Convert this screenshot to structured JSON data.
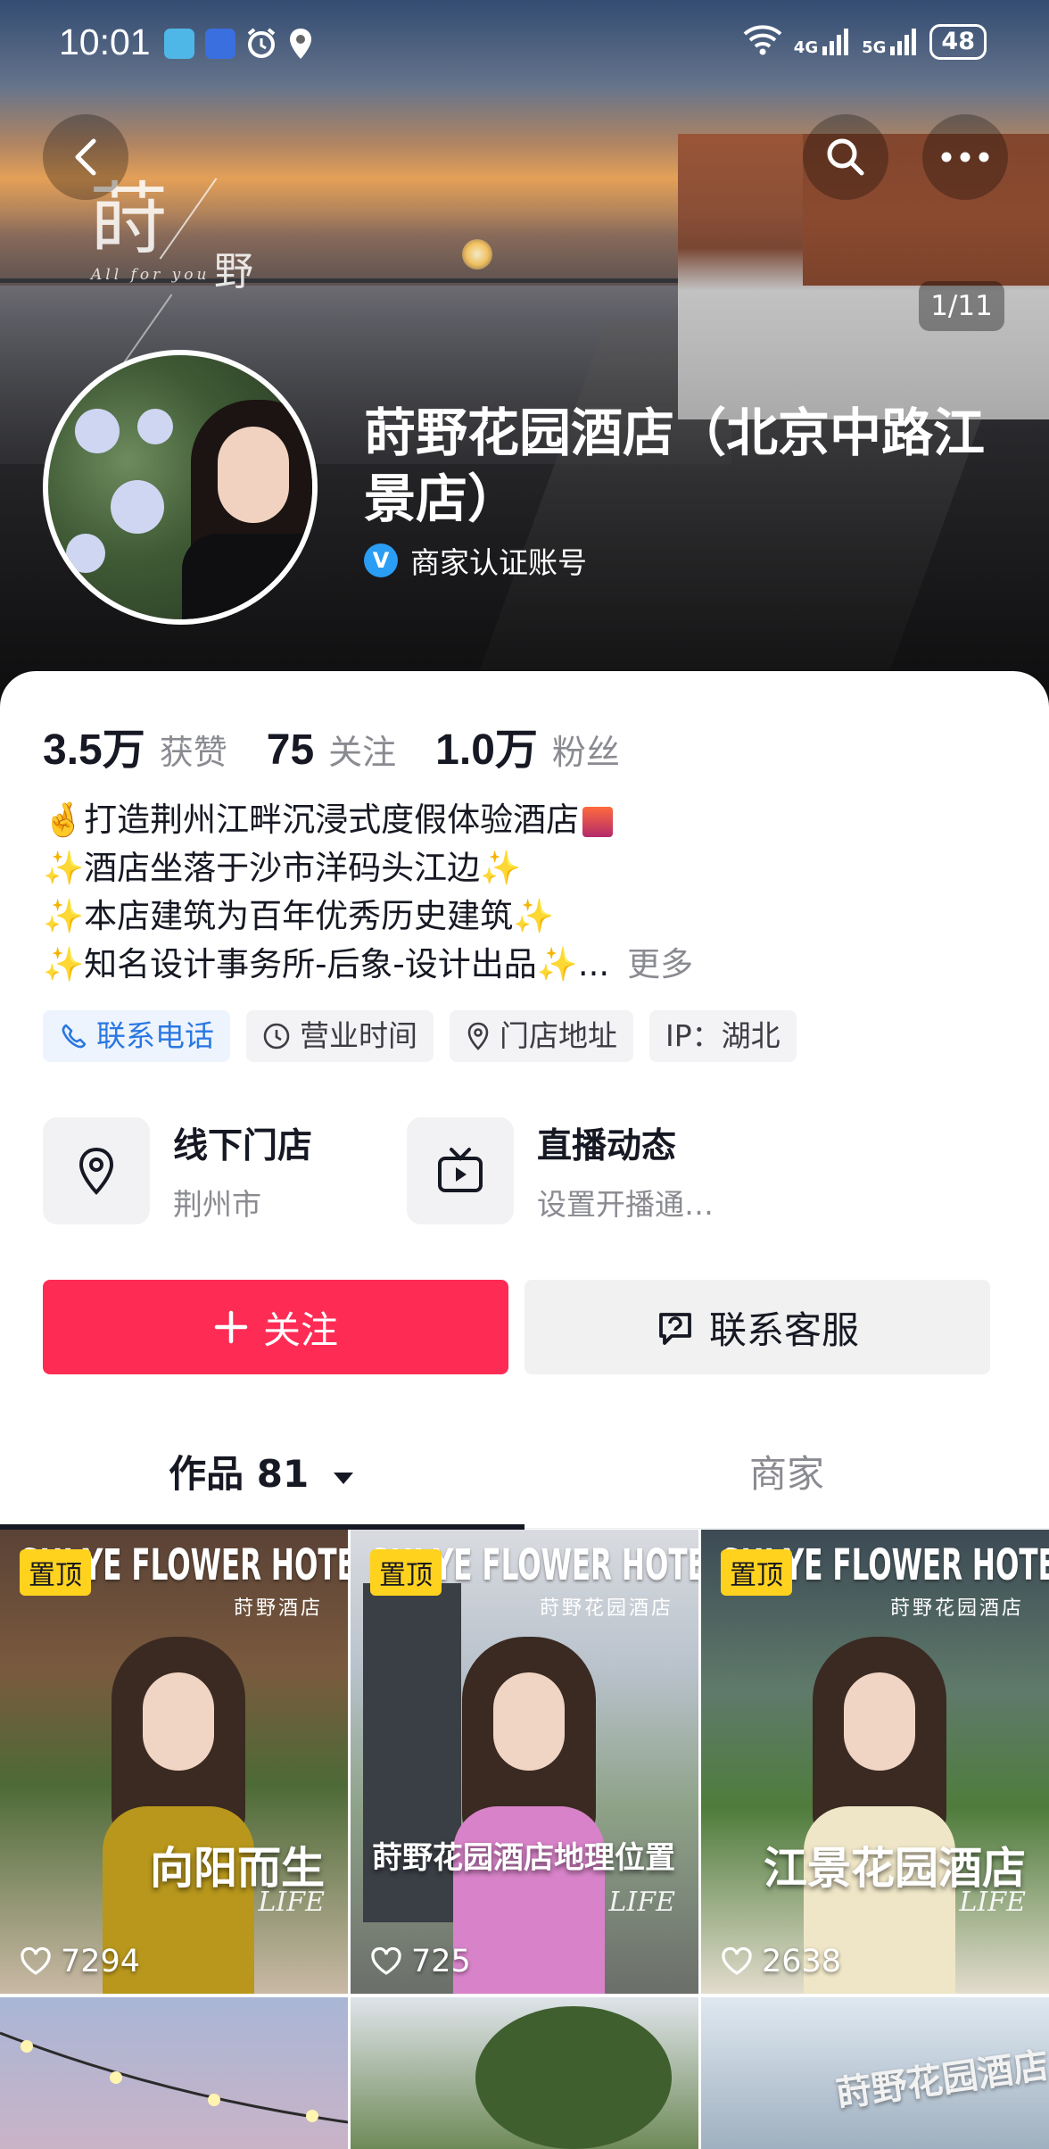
{
  "status_bar": {
    "time": "10:01",
    "network_4g": "4G",
    "network_5g": "5G",
    "battery": "48"
  },
  "hero": {
    "page_indicator": "1/11",
    "calligraphy_main": "莳",
    "calligraphy_sub": "野",
    "tagline": "All  for  you"
  },
  "profile": {
    "name": "莳野花园酒店（北京中路江景店）",
    "verified_label": "商家认证账号"
  },
  "stats": [
    {
      "value": "3.5万",
      "label": "获赞"
    },
    {
      "value": "75",
      "label": "关注"
    },
    {
      "value": "1.0万",
      "label": "粉丝"
    }
  ],
  "bio": {
    "line1": "打造荆州江畔沉浸式度假体验酒店",
    "line2": "酒店坐落于沙市洋码头江边",
    "line3": "本店建筑为百年优秀历史建筑",
    "line4": "知名设计事务所-后象-设计出品",
    "ellipsis": "...",
    "more": "更多"
  },
  "tags": {
    "phone": "联系电话",
    "hours": "营业时间",
    "address": "门店地址",
    "ip": "IP：湖北"
  },
  "entries": {
    "store_title": "线下门店",
    "store_sub": "荆州市",
    "live_title": "直播动态",
    "live_sub": "设置开播通…"
  },
  "buttons": {
    "follow": "关注",
    "contact": "联系客服"
  },
  "tabs": {
    "works": "作品 81",
    "shop": "商家"
  },
  "videos": [
    {
      "pin": "置顶",
      "brand": "SHI YE FLOWER HOTEL",
      "sub": "莳野酒店",
      "caption": "向阳而生",
      "life": "LIFE",
      "likes": "7294"
    },
    {
      "pin": "置顶",
      "brand": "SHI YE FLOWER HOTEL",
      "sub": "莳野花园酒店",
      "caption": "莳野花园酒店地理位置",
      "life": "LIFE",
      "likes": "725"
    },
    {
      "pin": "置顶",
      "brand": "SHI YE FLOWER HOTEL",
      "sub": "莳野花园酒店",
      "caption": "江景花园酒店",
      "life": "LIFE",
      "likes": "2638"
    }
  ],
  "bottom_row": {
    "sign_text": "莳野花园酒店"
  },
  "colors": {
    "follow_red": "#fe2c55",
    "pin_yellow": "#ffd21e",
    "link_blue": "#2a78e2"
  }
}
